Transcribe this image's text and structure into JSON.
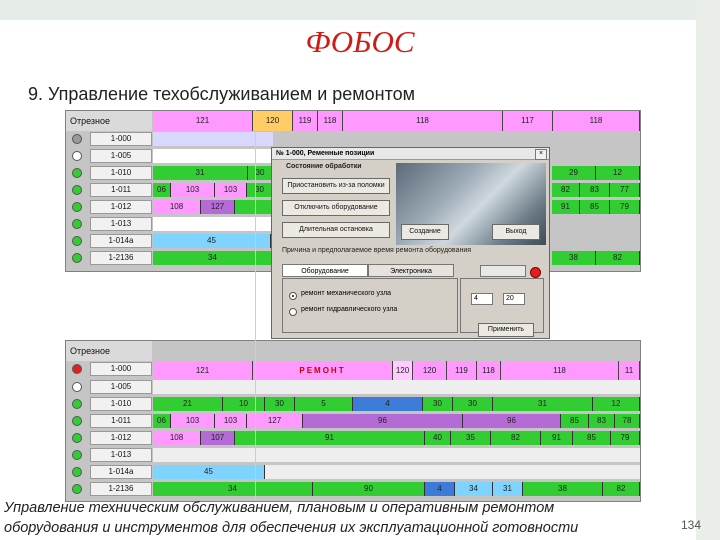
{
  "slide": {
    "title": "ФОБОС",
    "subtitle": "9. Управление техобслуживанием и ремонтом",
    "footer_line1": "Управление техническим обслуживанием, плановым и оперативным ремонтом",
    "footer_line2": "оборудования и инструментов для обеспечения их эксплуатационной готовности",
    "page_number": "134"
  },
  "colors": {
    "green": "#32cd32",
    "purple": "#8a2be2",
    "pink": "#ff99ff",
    "blue": "#3d7bd9",
    "cyan": "#7fd4ff",
    "yellow": "#ffff66",
    "gray": "#c0c0c0",
    "red": "#e02020"
  },
  "top_panel": {
    "header": "Отрезное",
    "timeline": [
      "121",
      "120",
      "119",
      "118",
      "118",
      "117",
      "118"
    ],
    "rows": [
      {
        "name": "1-000",
        "led": "gray",
        "segments": []
      },
      {
        "name": "1-005",
        "led": "none",
        "segments": []
      },
      {
        "name": "1-010",
        "led": "green",
        "segments": [
          {
            "label": "31",
            "color": "green"
          },
          {
            "label": "30",
            "color": "green"
          }
        ]
      },
      {
        "name": "1-011",
        "led": "green",
        "segments": [
          {
            "label": "06",
            "color": "green"
          },
          {
            "label": "103",
            "color": "pink"
          },
          {
            "label": "103",
            "color": "pink"
          },
          {
            "label": "30",
            "color": "green"
          }
        ]
      },
      {
        "name": "1-012",
        "led": "green",
        "segments": [
          {
            "label": "108",
            "color": "pink"
          },
          {
            "label": "127",
            "color": "purple"
          }
        ]
      },
      {
        "name": "1-013",
        "led": "green",
        "segments": []
      },
      {
        "name": "1-014а",
        "led": "green",
        "segments": [
          {
            "label": "45",
            "color": "cyan"
          }
        ]
      },
      {
        "name": "1-2136",
        "led": "green",
        "segments": [
          {
            "label": "34",
            "color": "green"
          }
        ]
      }
    ],
    "right_values": [
      "29",
      "12",
      "82",
      "83",
      "77",
      "91",
      "85",
      "79",
      "38",
      "82"
    ]
  },
  "dialog": {
    "title": "№ 1-000, Ременные позиции",
    "close": "×",
    "state_group": "Состояние обработки",
    "btn_suspend": "Приостановить из-за поломки",
    "btn_disable": "Отключить оборудование",
    "btn_long_stop": "Длительная остановка",
    "btn_create": "Создание",
    "btn_exit": "Выход",
    "reason_group": "Причина и предполагаемое время ремонта оборудования",
    "tab1": "Оборудование",
    "tab2": "Электроника",
    "radio1": "ремонт механического узла",
    "radio2": "ремонт гидравлического узла",
    "hours": "4",
    "minutes": "20",
    "btn_apply": "Применить"
  },
  "bottom_panel": {
    "header": "Отрезное",
    "timeline": [
      "121",
      "РЕМОНТ",
      "120",
      "120",
      "119",
      "118",
      "118",
      "11"
    ],
    "rows": [
      {
        "name": "1-000",
        "led": "red"
      },
      {
        "name": "1-005",
        "led": "none"
      },
      {
        "name": "1-010",
        "led": "green"
      },
      {
        "name": "1-011",
        "led": "green"
      },
      {
        "name": "1-012",
        "led": "green"
      },
      {
        "name": "1-013",
        "led": "green"
      },
      {
        "name": "1-014а",
        "led": "green"
      },
      {
        "name": "1-2136",
        "led": "green"
      }
    ],
    "row_labels": {
      "r2": [
        "21",
        "10",
        "30",
        "5",
        "4",
        "30",
        "30",
        "31",
        "12"
      ],
      "r3": [
        "06",
        "103",
        "103",
        "127",
        "96",
        "96",
        "85",
        "83",
        "78"
      ],
      "r4": [
        "108",
        "107",
        "91",
        "40",
        "35",
        "82",
        "91",
        "85",
        "79"
      ],
      "r6": [
        "45"
      ],
      "r7": [
        "34",
        "90",
        "4",
        "34",
        "31",
        "38",
        "82"
      ]
    }
  }
}
